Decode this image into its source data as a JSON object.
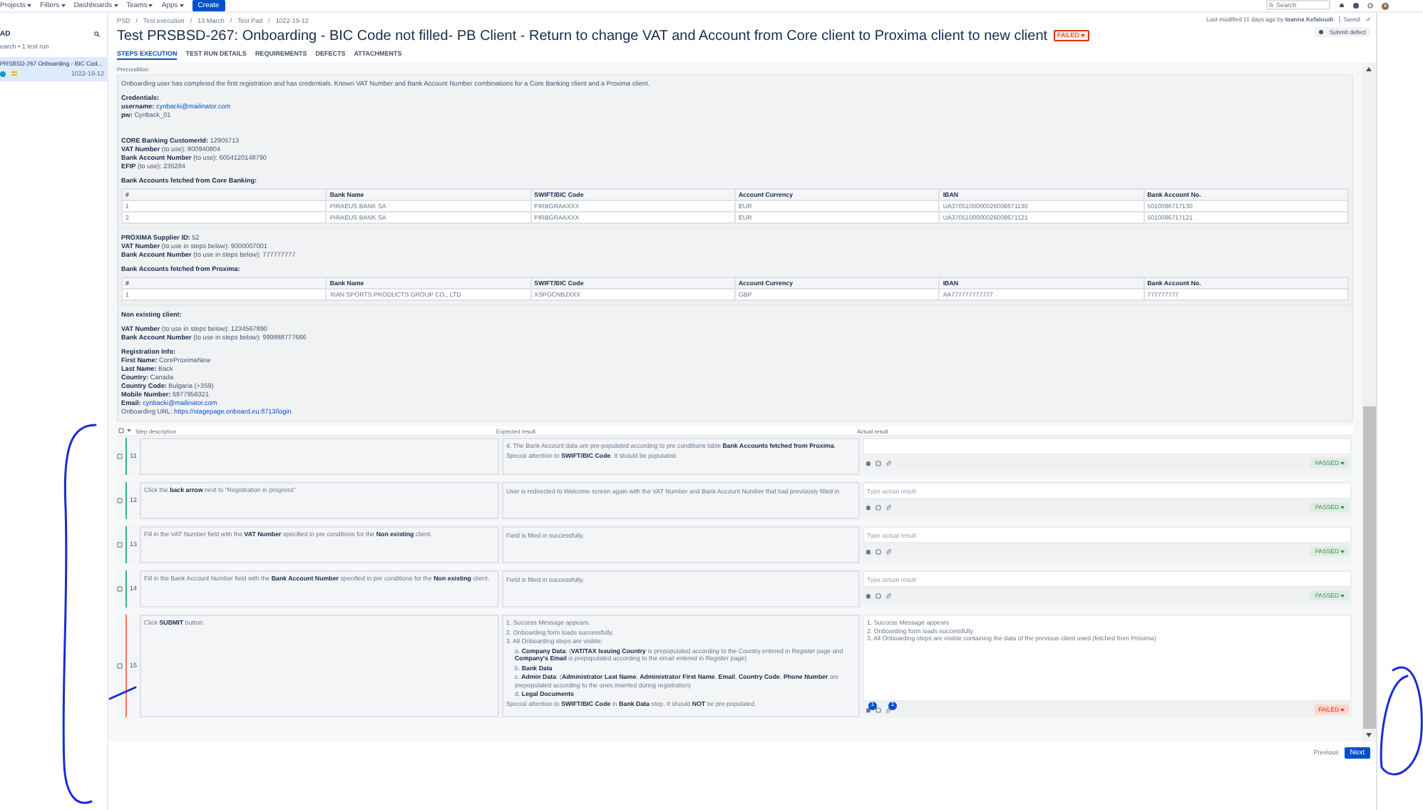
{
  "top_nav": {
    "menus": [
      "Projects",
      "Filters",
      "Dashboards",
      "Teams",
      "Apps"
    ],
    "create": "Create",
    "search": {
      "placeholder": "Search"
    }
  },
  "sidebar": {
    "title": "AD",
    "summary": "earch • 1 test run",
    "items": [
      {
        "title": "PRSBSD-267 Onboarding - BIC Cod...",
        "date": "1022-19-12",
        "selected": true
      }
    ]
  },
  "breadcrumbs": {
    "separator": "/",
    "items": [
      "PSD",
      "Test execution",
      "13 March",
      "Test Pad",
      "1022-19-12"
    ]
  },
  "title": "Test PRSBSD-267: Onboarding - BIC Code not filled- PB Client - Return to change VAT and Account from Core client to Proxima client to new client",
  "status": {
    "label": "FAILED",
    "kind": "failed"
  },
  "modified": "Last modified 11 days ago by **Ioanna Kefaloudi**",
  "saved": "Saved",
  "submit_defect": "Submit defect",
  "tabs": [
    {
      "label": "STEPS EXECUTION",
      "selected": true
    },
    {
      "label": "TEST RUN DETAILS",
      "selected": false
    },
    {
      "label": "REQUIREMENTS",
      "selected": false
    },
    {
      "label": "DEFECTS",
      "selected": false
    },
    {
      "label": "ATTACHMENTS",
      "selected": false
    }
  ],
  "precondition": {
    "label": "Precondition",
    "blocks": [
      {
        "kind": "line",
        "text": "Onboarding user has completed the first registration and has credentials. Known VAT Number and Bank Account Number combinations for a Core Banking client and a Proxima client."
      },
      {
        "kind": "gap"
      },
      {
        "kind": "line",
        "text": "**Credentials:**"
      },
      {
        "kind": "link_line",
        "label": "**username:**",
        "link": "cynbacki@mailinator.com"
      },
      {
        "kind": "line",
        "text": "**pw:** Cynback_01"
      },
      {
        "kind": "gap"
      },
      {
        "kind": "gap"
      },
      {
        "kind": "gap"
      },
      {
        "kind": "line",
        "text": "**CORE Banking CustomerId:** 12905713"
      },
      {
        "kind": "line",
        "text": "**VAT Number** (to use): 800940804"
      },
      {
        "kind": "line",
        "text": "**Bank Account Number** (to use): 6054120148790"
      },
      {
        "kind": "line",
        "text": "**EFIP** (to use): 235284"
      },
      {
        "kind": "gap"
      },
      {
        "kind": "line",
        "text": "**Bank Accounts fetched from Core Banking:**"
      },
      {
        "kind": "table",
        "columns": [
          "#",
          "Bank Name",
          "SWIFT/BIC Code",
          "Account Currency",
          "IBAN",
          "Bank Account No."
        ],
        "rows": [
          [
            "1",
            "PIRAEUS BANK SA",
            "PIRBGRAAXXX",
            "EUR",
            "UA3705100000026008671130",
            "5010086717130"
          ],
          [
            "2",
            "PIRAEUS BANK SA",
            "PIRBGRAAXXX",
            "EUR",
            "UA3705100000026008671121",
            "5010086717121"
          ]
        ]
      },
      {
        "kind": "line",
        "text": "**PROXIMA Supplier ID:** 52"
      },
      {
        "kind": "line",
        "text": "**VAT Number** (to use in steps below): 9000007001"
      },
      {
        "kind": "line",
        "text": "**Bank Account Number** (to use in steps below): 777777777"
      },
      {
        "kind": "gap"
      },
      {
        "kind": "line",
        "text": "**Bank Accounts fetched from Proxima:**"
      },
      {
        "kind": "table",
        "columns": [
          "#",
          "Bank Name",
          "SWIFT/BIC Code",
          "Account Currency",
          "IBAN",
          "Bank Account No."
        ],
        "rows": [
          [
            "1",
            "XIAN SPORTS PRODUCTS GROUP CO., LTD",
            "XSPGCNBJXXX",
            "GBP",
            "AA777777777777",
            "777777777"
          ]
        ]
      },
      {
        "kind": "line",
        "text": "**Non existing client:**"
      },
      {
        "kind": "gap"
      },
      {
        "kind": "line",
        "text": "**VAT Number** (to use in steps below): 1234567890"
      },
      {
        "kind": "line",
        "text": "**Bank Account Number** (to use in steps below): 999888777666"
      },
      {
        "kind": "gap"
      },
      {
        "kind": "line",
        "text": "**Registration Info:**"
      },
      {
        "kind": "line",
        "text": "**First Name:** CoreProximaNew"
      },
      {
        "kind": "line",
        "text": "**Last Name:** Back"
      },
      {
        "kind": "line",
        "text": "**Country:** Canada"
      },
      {
        "kind": "line",
        "text": "**Country Code:** Bulgaria (+359)"
      },
      {
        "kind": "line",
        "text": "**Mobile Number:** 6977956321"
      },
      {
        "kind": "link_line",
        "label": "**Email:**",
        "link": "cynbacki@mailinator.com"
      },
      {
        "kind": "link_line",
        "label": "Onboarding URL:",
        "link": "https://stagepage.onboard.eu:8713/login"
      }
    ]
  },
  "steps_header": {
    "checked": false,
    "columns": [
      "Step description",
      "Expected result",
      "Actual result"
    ]
  },
  "steps": [
    {
      "number": "11",
      "checked": false,
      "expected": [
        {
          "kind": "item",
          "text": "4. The Bank Account data are pre-populated according to pre conditions table **Bank Accounts fetched from Proxima**."
        },
        {
          "kind": "para",
          "text": "Special attention to **SWIFT/BIC Code**. It should be populated."
        }
      ],
      "result": {
        "label": "PASSED",
        "kind": "passed"
      }
    },
    {
      "number": "12",
      "checked": false,
      "description": "Click the **back arrow** next to \"Registration in progress\"",
      "expected": [
        {
          "kind": "para",
          "text": "User is redirected to Welcome screen again with the VAT Number and Bank Account Number that had previously filled in"
        }
      ],
      "actual": {
        "placeholder": "Type actual result"
      },
      "result": {
        "label": "PASSED",
        "kind": "passed"
      }
    },
    {
      "number": "13",
      "checked": false,
      "description": "Fill in the VAT Number field with the **VAT Number** specified in pre conditions for the **Non existing** client.",
      "expected": [
        {
          "kind": "para",
          "text": "Field is filled in successfully."
        }
      ],
      "actual": {
        "placeholder": "Type actual result"
      },
      "result": {
        "label": "PASSED",
        "kind": "passed"
      }
    },
    {
      "number": "14",
      "checked": false,
      "description": "Fill in the Bank Account Number field with the **Bank Account Number** specified in pre conditions for the **Non existing** client.",
      "expected": [
        {
          "kind": "para",
          "text": "Field is filled in successfully."
        }
      ],
      "actual": {
        "placeholder": "Type actual result"
      },
      "result": {
        "label": "PASSED",
        "kind": "passed"
      }
    },
    {
      "number": "15",
      "checked": false,
      "description": "Click **SUBMIT** button.",
      "expected": [
        {
          "kind": "item",
          "text": "1. Success Message appears."
        },
        {
          "kind": "item",
          "text": "2. Onboarding form loads successfully."
        },
        {
          "kind": "item",
          "text": "3. All Onboarding steps are visible:"
        },
        {
          "kind": "subitem",
          "text": "a. **Company Data**: (**VAT/TAX Issuing Country** is prepopulated according to the Country entered in Register page and **Company's Email** is prepopulated according to the email entered in Register page)"
        },
        {
          "kind": "subitem",
          "text": "b. **Bank Data**"
        },
        {
          "kind": "subitem",
          "text": "c. **Admin Data**: (**Administrator Last Name**, **Administrator First Name**, **Email**, **Country Code**, **Phone Number** are prepopulated according to the ones inserted during registration)"
        },
        {
          "kind": "subitem",
          "text": "d. **Legal Documents**"
        },
        {
          "kind": "para",
          "text": "Special attention to **SWIFT/BIC Code** in **Bank Data** step. It should **NOT** be pre-populated."
        }
      ],
      "actual": {
        "value": "1. Success Message appears\n2. Onboarding form loads successfully\n3. All Onboarding steps are visible containing the data of the previous client used (fetched from Proxima)"
      },
      "defects_count": "1",
      "attachments_count": "1",
      "result": {
        "label": "FAILED",
        "kind": "failed"
      }
    }
  ],
  "footer": {
    "previous": "Previous",
    "next": "Next"
  }
}
